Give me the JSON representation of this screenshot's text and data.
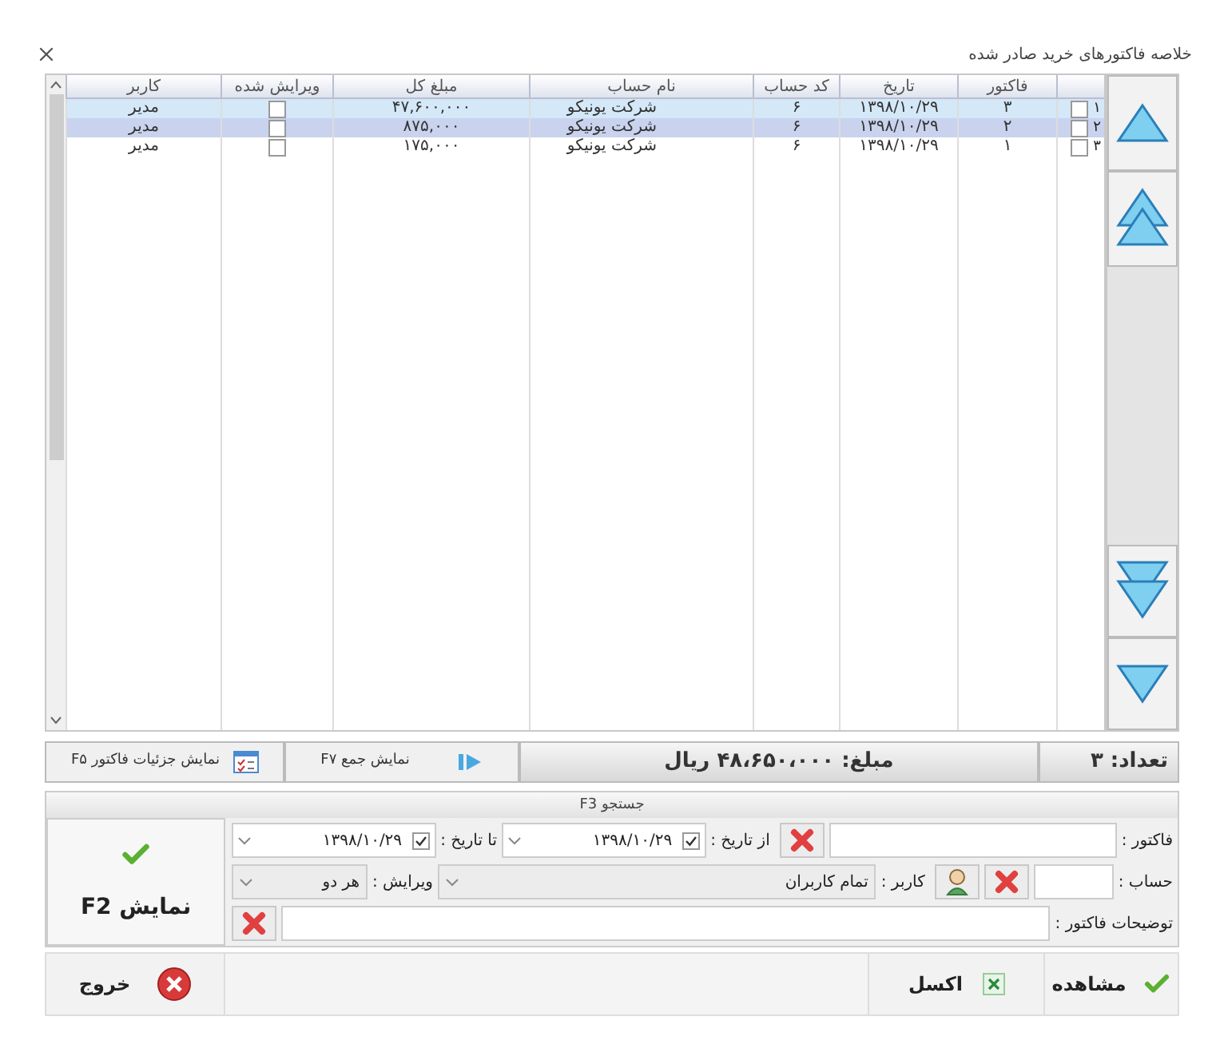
{
  "window": {
    "title": "خلاصه فاکتورهای خرید صادر شده"
  },
  "grid": {
    "columns": [
      "فاکتور",
      "تاریخ",
      "کد حساب",
      "نام حساب",
      "مبلغ کل",
      "ویرایش شده",
      "کاربر"
    ],
    "rows": [
      {
        "number": "۱",
        "checked": false,
        "selected": true,
        "invoice": "۳",
        "date": "۱۳۹۸/۱۰/۲۹",
        "account_code": "۶",
        "account_name": "شرکت یونیکو",
        "total": "۴۷,۶۰۰,۰۰۰",
        "edited": false,
        "user": "مدیر"
      },
      {
        "number": "۲",
        "checked": false,
        "selected": true,
        "invoice": "۲",
        "date": "۱۳۹۸/۱۰/۲۹",
        "account_code": "۶",
        "account_name": "شرکت یونیکو",
        "total": "۸۷۵,۰۰۰",
        "edited": false,
        "user": "مدیر"
      },
      {
        "number": "۳",
        "checked": false,
        "selected": false,
        "invoice": "۱",
        "date": "۱۳۹۸/۱۰/۲۹",
        "account_code": "۶",
        "account_name": "شرکت یونیکو",
        "total": "۱۷۵,۰۰۰",
        "edited": false,
        "user": "مدیر"
      }
    ]
  },
  "nav_buttons": [
    {
      "kind": "up"
    },
    {
      "kind": "first"
    },
    {
      "kind": "last"
    },
    {
      "kind": "down"
    }
  ],
  "summary": {
    "count": "تعداد: ۳",
    "amount": "مبلغ: ۴۸،۶۵۰،۰۰۰ ریال",
    "total_button": "نمایش جمع F۷",
    "details_button": "نمایش جزئیات فاکتور F۵"
  },
  "search": {
    "title": "جستجو F3",
    "invoice_label": "فاکتور :",
    "from_label": "از تاریخ :",
    "from_checked": true,
    "from_date": "۱۳۹۸/۱۰/۲۹",
    "to_label": "تا تاریخ :",
    "to_checked": true,
    "to_date": "۱۳۹۸/۱۰/۲۹",
    "account_label": "حساب :",
    "user_label": "کاربر :",
    "user_value": "تمام کاربران",
    "edit_label": "ویرایش :",
    "edit_value": "هر دو",
    "notes_label": "توضیحات فاکتور :",
    "show_button": "نمایش F2"
  },
  "footer": {
    "view_button": "مشاهده",
    "excel_button": "اکسل",
    "exit_button": "خروج"
  }
}
